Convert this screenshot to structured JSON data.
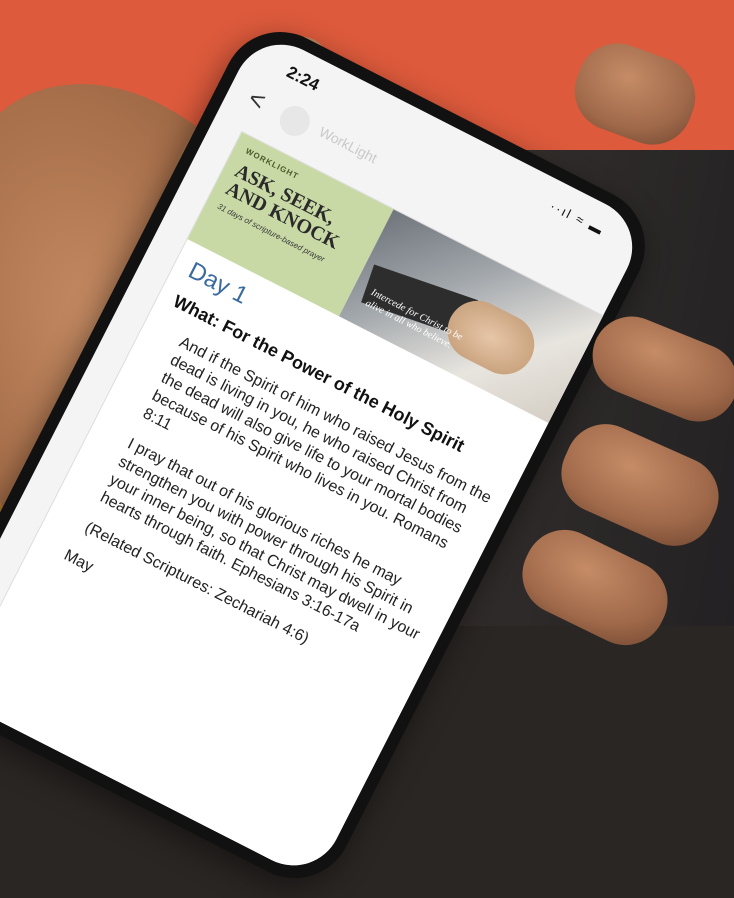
{
  "status_bar": {
    "time": "2:24",
    "icons": "··ıl ≈ ▬"
  },
  "mail": {
    "back_glyph": "<",
    "sender": "WorkLight",
    "actions": [
      "⤓",
      "🗑",
      "✉",
      "···"
    ]
  },
  "banner": {
    "brand": "WORKLIGHT",
    "title": "ASK, SEEK, AND KNOCK",
    "subtitle": "31 days of scripture-based prayer",
    "caption": "Intercede for Christ to be alive in all who believe."
  },
  "content": {
    "day": "Day 1",
    "heading": "What: For the Power of the Holy Spirit",
    "paragraph_1": "And if the Spirit of him who raised Jesus from the dead is living in you, he who raised Christ from the dead will also give life to your mortal bodies because of his Spirit who lives in you. Romans 8:11",
    "paragraph_2": "I pray that out of his glorious riches he may strengthen you with power through his Spirit in your inner being, so that Christ may dwell in your hearts through faith. Ephesians 3:16-17a",
    "paragraph_3": "(Related Scriptures: Zechariah 4:6)",
    "paragraph_4": "May"
  },
  "colors": {
    "top_band": "#dd5a3c",
    "banner_green": "#c9d9a5",
    "day_blue": "#3a6aa0"
  }
}
